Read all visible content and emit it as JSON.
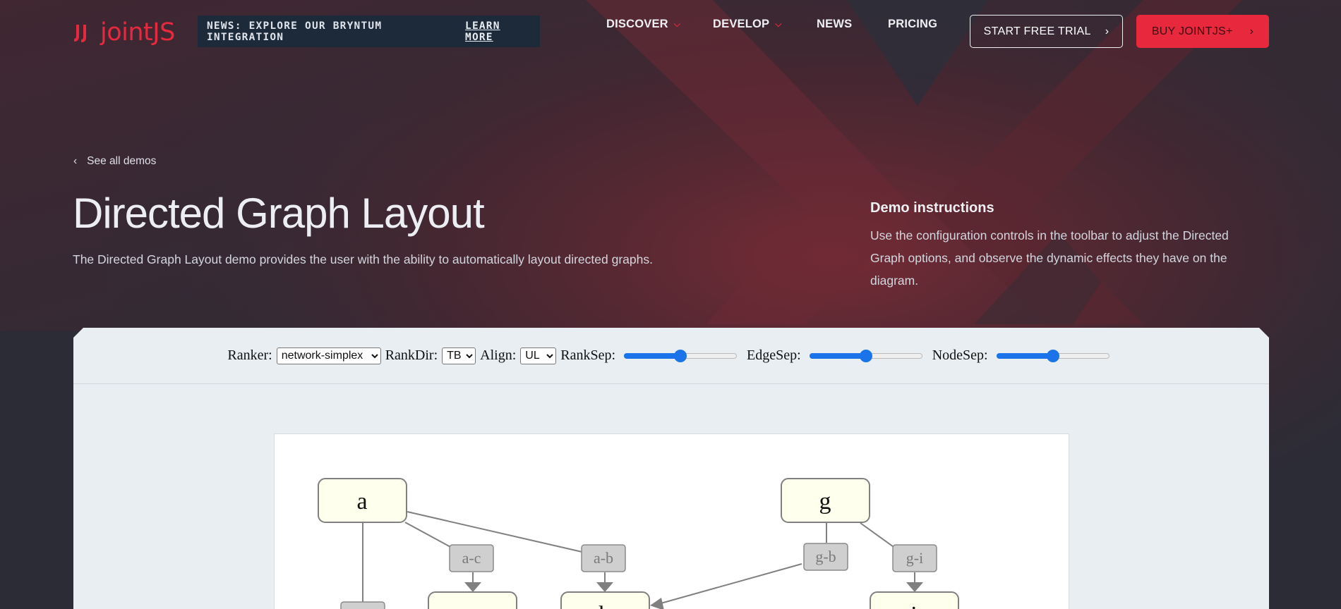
{
  "header": {
    "logo_text": "jointJS",
    "news_banner": "NEWS: EXPLORE OUR BRYNTUM INTEGRATION",
    "news_link": "LEARN MORE",
    "nav": [
      {
        "label": "DISCOVER",
        "has_dropdown": true
      },
      {
        "label": "DEVELOP",
        "has_dropdown": true
      },
      {
        "label": "NEWS",
        "has_dropdown": false
      },
      {
        "label": "PRICING",
        "has_dropdown": false
      }
    ],
    "trial_button": "START FREE TRIAL",
    "buy_button": "BUY JOINTJS+"
  },
  "hero": {
    "back_link": "See all demos",
    "title": "Directed Graph Layout",
    "description": "The Directed Graph Layout demo provides the user with the ability to automatically layout directed graphs.",
    "instructions_title": "Demo instructions",
    "instructions_text": "Use the configuration controls in the toolbar to adjust the Directed Graph options, and observe the dynamic effects they have on the diagram."
  },
  "toolbar": {
    "ranker_label": "Ranker:",
    "ranker_value": "network-simplex",
    "rankdir_label": "RankDir:",
    "rankdir_value": "TB",
    "align_label": "Align:",
    "align_value": "UL",
    "ranksep_label": "RankSep:",
    "ranksep_value": 0.5,
    "edgesep_label": "EdgeSep:",
    "edgesep_value": 0.5,
    "nodesep_label": "NodeSep:",
    "nodesep_value": 0.5
  },
  "graph": {
    "nodes": [
      "a",
      "g",
      "b",
      "i"
    ],
    "edge_labels": [
      "a-c",
      "a-b",
      "g-b",
      "g-i"
    ]
  },
  "colors": {
    "accent": "#e8283c",
    "banner_bg": "#1c2a39",
    "slider": "#1a73e8",
    "node_fill": "#ffffee",
    "label_fill": "#cfcfcf"
  }
}
